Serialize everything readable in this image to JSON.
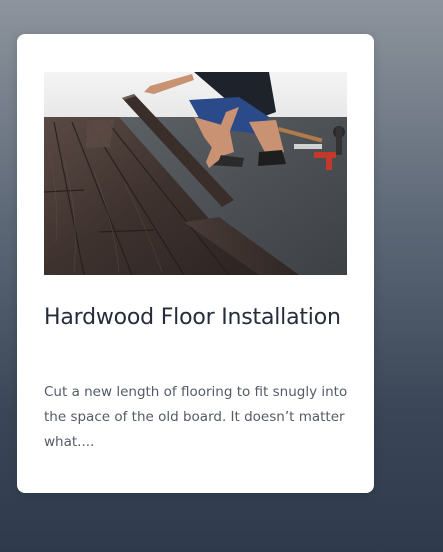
{
  "card": {
    "image_alt": "Person installing dark hardwood floor planks",
    "title": "Hardwood Floor Installation",
    "excerpt": "Cut a new length of flooring to fit snugly into the space of the old board. It doesn’t matter what...."
  },
  "colors": {
    "card_background": "#ffffff",
    "title": "#262d3a",
    "excerpt": "#555b66",
    "page_gradient_top": "#8d949d",
    "page_gradient_bottom": "#2f3b4c"
  }
}
